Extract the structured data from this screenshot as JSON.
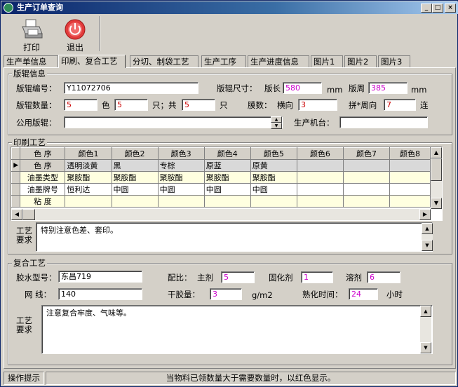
{
  "window": {
    "title": "生产订单查询",
    "min": "_",
    "max": "□",
    "close": "×"
  },
  "toolbar": {
    "print_label": "打印",
    "exit_label": "退出"
  },
  "tabs": [
    "生产单信息",
    "印刷、复合工艺",
    "分切、制袋工艺",
    "生产工序",
    "生产进度信息",
    "图片1",
    "图片2",
    "图片3"
  ],
  "plate": {
    "legend": "版辊信息",
    "no_label": "版辊编号：",
    "no_value": "Y11072706",
    "size_label": "版辊尺寸：",
    "len_label": "版长",
    "len_value": "580",
    "mm1": "mm",
    "circ_label": "版周",
    "circ_value": "385",
    "mm2": "mm",
    "qty_label": "版辊数量：",
    "qty_value": "5",
    "color_unit": "色",
    "color_value": "5",
    "pcs_label": "只；共",
    "total_value": "5",
    "pcs_unit": "只",
    "film_label": "膜数：",
    "across_label": "横向",
    "across_value": "3",
    "panel_label": "拼*周向",
    "panel_value": "7",
    "link_unit": "连",
    "shared_label": "公用版辊：",
    "shared_value": "",
    "machine_label": "生产机台：",
    "machine_value": ""
  },
  "printing": {
    "legend": "印刷工艺",
    "headers": [
      "色 序",
      "颜色1",
      "颜色2",
      "颜色3",
      "颜色4",
      "颜色5",
      "颜色6",
      "颜色7",
      "颜色8"
    ],
    "rows": [
      [
        "色 序",
        "透明淡黄",
        "黑",
        "专棕",
        "原蓝",
        "原黄",
        "",
        "",
        ""
      ],
      [
        "油墨类型",
        "聚胺酯",
        "聚胺酯",
        "聚胺酯",
        "聚胺酯",
        "聚胺酯",
        "",
        "",
        ""
      ],
      [
        "油墨牌号",
        "恒利达",
        "中圆",
        "中圆",
        "中圆",
        "中圆",
        "",
        "",
        ""
      ],
      [
        "粘 度",
        "",
        "",
        "",
        "",
        "",
        "",
        "",
        ""
      ]
    ],
    "req_label_1": "工艺",
    "req_label_2": "要求",
    "req_text": "特别注意色差、套印。"
  },
  "lamination": {
    "legend": "复合工艺",
    "glue_label": "胶水型号：",
    "glue_value": "东昌719",
    "ratio_label": "配比：",
    "main_label": "主剂",
    "main_value": "5",
    "cure_label": "固化剂",
    "cure_value": "1",
    "solvent_label": "溶剂",
    "solvent_value": "6",
    "mesh_label": "网  线：",
    "mesh_value": "140",
    "dry_label": "干胶量：",
    "dry_value": "3",
    "dry_unit": "g/m2",
    "age_label": "熟化时间：",
    "age_value": "24",
    "age_unit": "小时",
    "req_label_1": "工艺",
    "req_label_2": "要求",
    "req_text": "注意复合牢度、气味等。"
  },
  "status": {
    "hint_label": "操作提示",
    "message": "当物料已领数量大于需要数量时，以红色显示。"
  }
}
